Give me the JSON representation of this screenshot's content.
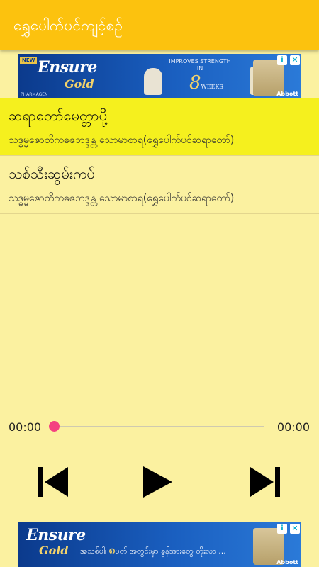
{
  "app": {
    "title": "ရွှေပေါက်ပင်ကျင့်စဉ်"
  },
  "ads": {
    "top": {
      "new_tag": "NEW",
      "brand": "Ensure",
      "product": "Gold",
      "tagline": "IMPROVES STRENGTH IN",
      "tagline_number": "8",
      "tagline_unit": "WEEKS",
      "partner": "PHARMAGEN",
      "maker": "Abbott",
      "info_icon": "info-icon",
      "close_icon": "close-icon"
    },
    "bottom": {
      "brand": "Ensure",
      "product": "Gold",
      "promo_pre": "အသစ်ပါ၊",
      "promo_num": "၈",
      "promo_post": "ပတ် အတွင်းမှာ ခွန်အားတွေ တိုးလာ ...",
      "maker": "Abbott",
      "info_icon": "info-icon",
      "close_icon": "close-icon"
    }
  },
  "tracks": [
    {
      "title": "ဆရာတော်မေတ္တာပို့",
      "subtitle": "သဒ္ဓမ္မဇောတိကဓဇဘဒ္ဒန္တ သောမာစာရ(ရွှေပေါက်ပင်ဆရာတော်)",
      "selected": true
    },
    {
      "title": "သစ်သီးဆွမ်းကပ်",
      "subtitle": "သဒ္ဓမ္မဇောတိကဓဇဘဒ္ဒန္တ သောမာစာရ(ရွှေပေါက်ပင်ဆရာတော်)",
      "selected": false
    }
  ],
  "player": {
    "current_time": "00:00",
    "total_time": "00:00",
    "progress": 0,
    "controls": {
      "previous": "skip-previous-icon",
      "play": "play-icon",
      "next": "skip-next-icon"
    }
  },
  "colors": {
    "app_bar": "#FCC20E",
    "background": "#FBF1A0",
    "selected_row": "#F5F01E",
    "seek_thumb": "#F44180"
  }
}
